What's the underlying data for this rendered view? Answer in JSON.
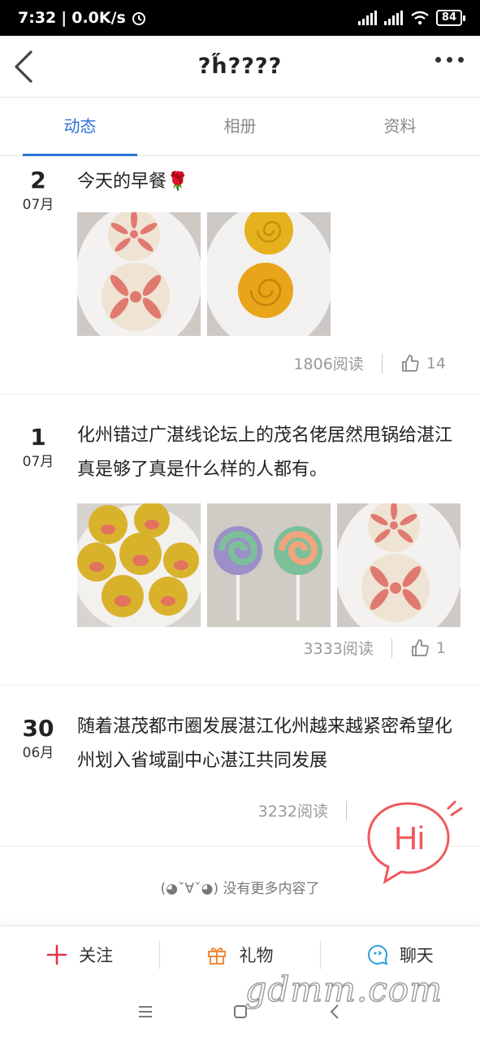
{
  "status_bar": {
    "time": "7:32",
    "speed": "0.0K/s",
    "battery": "84"
  },
  "header": {
    "title": "?h̋????"
  },
  "tabs": [
    {
      "label": "动态",
      "active": true
    },
    {
      "label": "相册",
      "active": false
    },
    {
      "label": "资料",
      "active": false
    }
  ],
  "posts": [
    {
      "day": "2",
      "month": "07月",
      "text": "今天的早餐🌹",
      "reads": "1806阅读",
      "likes": "14"
    },
    {
      "day": "1",
      "month": "07月",
      "text": "化州错过广湛线论坛上的茂名佬居然甩锅给湛江真是够了真是什么样的人都有。",
      "reads": "3333阅读",
      "likes": "1"
    },
    {
      "day": "30",
      "month": "06月",
      "text": "随着湛茂都市圈发展湛江化州越来越紧密希望化州划入省域副中心湛江共同发展",
      "reads": "3232阅读",
      "likes": ""
    }
  ],
  "footer_note": "(◕ˇ∀ˇ◕) 没有更多内容了",
  "hi_bubble": "Hi",
  "actions": [
    {
      "label": "关注",
      "icon": "plus-icon"
    },
    {
      "label": "礼物",
      "icon": "gift-icon"
    },
    {
      "label": "聊天",
      "icon": "chat-icon"
    }
  ],
  "watermark": "gdmm.com",
  "colors": {
    "accent": "#2f6fd6",
    "follow_red": "#e0344b",
    "gift_orange": "#f08a3c",
    "chat_blue": "#2aa0e0",
    "hi_red": "#f0595c"
  }
}
